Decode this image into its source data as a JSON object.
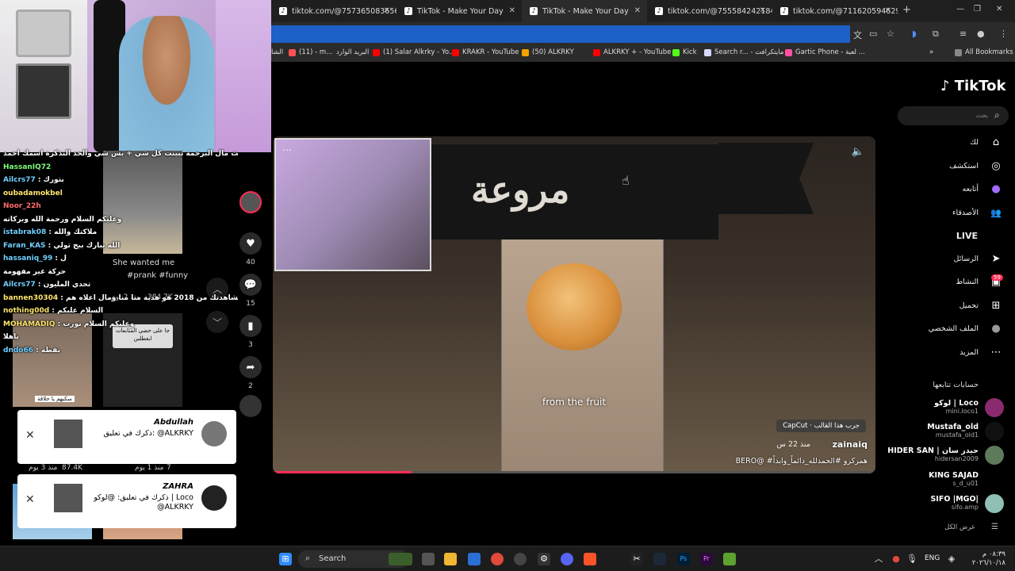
{
  "chat": [
    {
      "user": "",
      "msg": "خريطة اليوم البث مال البرجمة تبينت كل شي + يس شي والحد التذكرة اسمك احمد",
      "cls": "y"
    },
    {
      "user": "HassanIQ72",
      "msg": "",
      "cls": "g"
    },
    {
      "user": "Ailcrs77",
      "msg": "بتورك",
      "cls": ""
    },
    {
      "user": "oubadamokbel",
      "msg": "",
      "cls": "y"
    },
    {
      "user": "Noor_22h",
      "msg": "",
      "cls": "r"
    },
    {
      "user": "",
      "msg": "وعليكم السلام ورحمة الله وبركاته",
      "cls": "g"
    },
    {
      "user": "istabrak08",
      "msg": "ملاكتك والله",
      "cls": ""
    },
    {
      "user": "Faran_KAS",
      "msg": "الله يبارك بيج تولي",
      "cls": ""
    },
    {
      "user": "hassaniq_99",
      "msg": "ل",
      "cls": ""
    },
    {
      "user": "",
      "msg": "حركة غير مفهومة",
      "cls": ""
    },
    {
      "user": "Ailcrs77",
      "msg": "تحدي المليون",
      "cls": ""
    },
    {
      "user": "bannen30304",
      "msg": "شكراً ستالر مشاهدتك من 2018 هو هدية منا منا ومال اعلاه هم",
      "cls": "y"
    },
    {
      "user": "nothing00d",
      "msg": "السلام عليكم",
      "cls": "y"
    },
    {
      "user": "MOHAMADIQ",
      "msg": "وعليكم السلام نورت",
      "cls": "y"
    },
    {
      "user": "",
      "msg": "ياهلا",
      "cls": "r"
    },
    {
      "user": "dndo66",
      "msg": "نقطة",
      "cls": ""
    }
  ],
  "left": {
    "thumb1_title": "She wanted me",
    "thumb1_tags": "#prank #funny",
    "thumb1_views": "384.7K",
    "thumb1_time": "منذ 2 يوم",
    "thumb3_note": "جا على حضي المتابعات ابغطلبن",
    "thumb2_label": "سكبهم يا حلاقة",
    "row2_left_views": "87.4K",
    "row2_left_time": "منذ 3 يوم",
    "row2_right_views": "7",
    "row2_right_time": "منذ 1 يوم",
    "likes": "40",
    "comments": "15",
    "saves": "3",
    "shares": "2"
  },
  "notifications": [
    {
      "name": "Abdullah",
      "msg": "ذكرك في تعليق: @ALKRKY"
    },
    {
      "name": "ZAHRA",
      "msg": "ذكرك في تعليق: @لوكو | Loco @ALKRKY"
    }
  ],
  "browser": {
    "tabs": [
      {
        "label": "tiktok.com/@7573650836565...",
        "active": false
      },
      {
        "label": "TikTok - Make Your Day",
        "active": false
      },
      {
        "label": "TikTok - Make Your Day",
        "active": true
      },
      {
        "label": "tiktok.com/@755584242184...",
        "active": false
      },
      {
        "label": "tiktok.com/@71162059462971...",
        "active": false
      }
    ],
    "new_tab": "+",
    "bookmarks": [
      {
        "label": "الشا",
        "color": "#888"
      },
      {
        "label": "(11) - m...",
        "color": "#ff5252"
      },
      {
        "label": "البريد الوارد",
        "color": "#ffffff"
      },
      {
        "label": "(1) Salar Alkrky - Yo...",
        "color": "#ff0000"
      },
      {
        "label": "KRAKR - YouTube",
        "color": "#ff0000"
      },
      {
        "label": "(50) ALKRKY",
        "color": "#f4a300"
      },
      {
        "label": "ALKRKY + - YouTube",
        "color": "#ff0000"
      },
      {
        "label": "Kick",
        "color": "#53fc18"
      },
      {
        "label": "Search r... - مايتكرافت",
        "color": "#e0e0ff"
      },
      {
        "label": "Gartic Phone - لعبة ...",
        "color": "#ff4fa0"
      }
    ],
    "all_bookmarks": "All Bookmarks"
  },
  "tiktok": {
    "logo": "TikTok",
    "search_placeholder": "بحث",
    "nav": [
      {
        "label": "لك",
        "icon": "home-icon",
        "glyph": "⌂"
      },
      {
        "label": "استكشف",
        "icon": "compass-icon",
        "glyph": "◎"
      },
      {
        "label": "أتابعه",
        "icon": "avatar-icon",
        "glyph": "●"
      },
      {
        "label": "الأصدقاء",
        "icon": "friends-icon",
        "glyph": "👥"
      },
      {
        "label": "LIVE",
        "icon": "live-icon",
        "glyph": ""
      },
      {
        "label": "الرسائل",
        "icon": "send-icon",
        "glyph": "➤"
      },
      {
        "label": "النشاط",
        "icon": "inbox-icon",
        "glyph": "▣"
      },
      {
        "label": "تحميل",
        "icon": "upload-icon",
        "glyph": "⊞"
      },
      {
        "label": "الملف الشخصي",
        "icon": "profile-icon",
        "glyph": "●"
      },
      {
        "label": "المزيد",
        "icon": "more-icon",
        "glyph": "⋯"
      }
    ],
    "activity_badge": "59",
    "following_title": "حسابات تتابعها",
    "accounts": [
      {
        "name": "لوكو | Loco",
        "handle": "mini.loco1"
      },
      {
        "name": "Mustafa_old",
        "handle": "mustafa_old1"
      },
      {
        "name": "HIDER SAN | حيدر سان",
        "handle": "hidersan2009"
      },
      {
        "name": "KING SAJAD",
        "handle": "s_d_u01"
      },
      {
        "name": "SIFO |MGO|",
        "handle": "sifo.amp"
      }
    ],
    "see_all": "عرض الكل"
  },
  "video": {
    "banner_text": "مروعة",
    "caption": "from the fruit",
    "author": "zainaiq",
    "time": "منذ 22 س",
    "desc": "BERO@ #همركرو #الحمدلله_دائماً_وابداً",
    "capcut": "CapCut · جرب هذا القالب",
    "progress": 0.23
  },
  "taskbar": {
    "search": "Search",
    "lang": "ENG",
    "time": "٠٨:٣٩ م",
    "date": "٢٠٢٦/١٠/١٨"
  }
}
